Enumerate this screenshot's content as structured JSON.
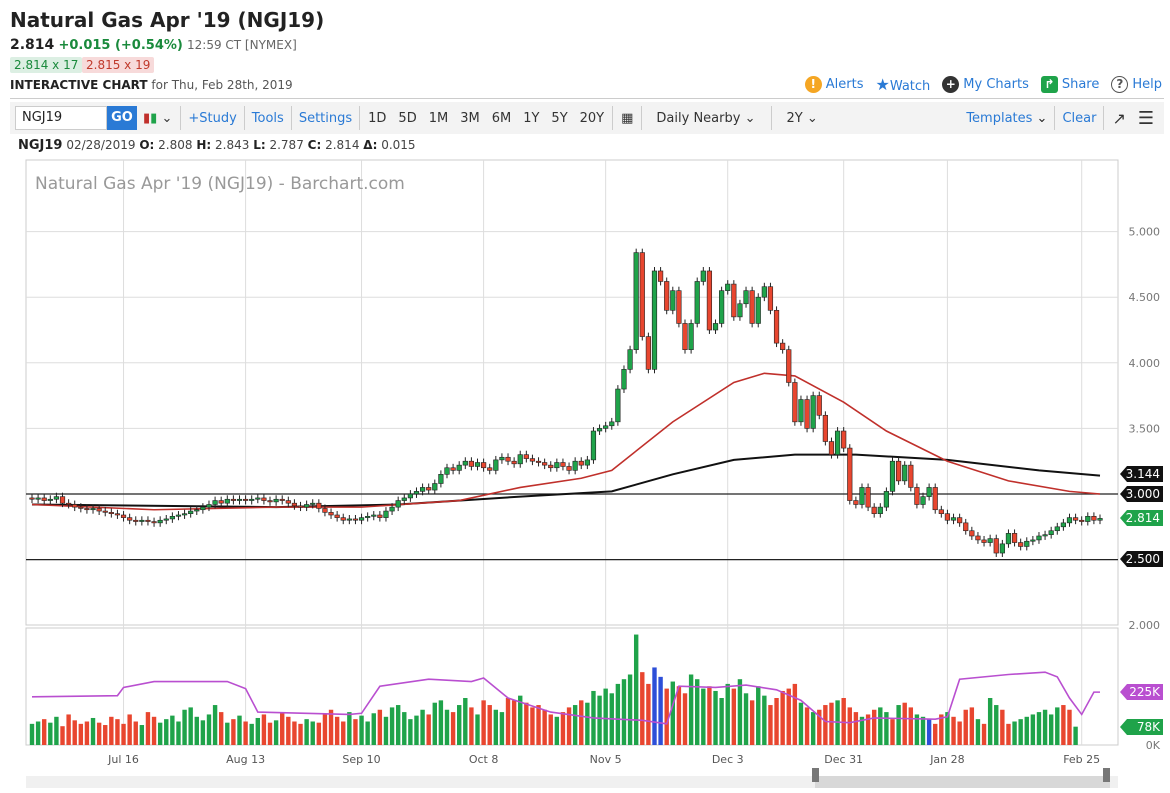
{
  "header": {
    "title": "Natural Gas Apr '19 (NGJ19)",
    "last": "2.814",
    "change": "+0.015 (+0.54%)",
    "time": "12:59 CT [NYMEX]",
    "bid": "2.814 x 17",
    "ask": "2.815 x 19",
    "ic_label": "INTERACTIVE CHART",
    "ic_date": "for Thu, Feb 28th, 2019"
  },
  "links": {
    "alerts": "Alerts",
    "watch": "Watch",
    "mycharts": "My Charts",
    "share": "Share",
    "help": "Help"
  },
  "toolbar": {
    "symbol": "NGJ19",
    "go": "GO",
    "study": "+Study",
    "tools": "Tools",
    "settings": "Settings",
    "periods": [
      "1D",
      "5D",
      "1M",
      "3M",
      "6M",
      "1Y",
      "5Y",
      "20Y"
    ],
    "interval": "Daily Nearby",
    "range": "2Y",
    "templates": "Templates",
    "clear": "Clear"
  },
  "ohlc": {
    "symbol": "NGJ19",
    "date": "02/28/2019",
    "o_label": "O:",
    "o": "2.808",
    "h_label": "H:",
    "h": "2.843",
    "l_label": "L:",
    "l": "2.787",
    "c_label": "C:",
    "c": "2.814",
    "d_label": "Δ:",
    "d": "0.015"
  },
  "colors": {
    "up": "#1fa34a",
    "down": "#e8462f",
    "ma_short": "#c0302b",
    "ma_long": "#111111",
    "oi": "#b94fd0",
    "vol_blue": "#2d4fd8"
  },
  "chart_data": {
    "type": "candlestick",
    "title": "Natural Gas Apr '19 (NGJ19) - Barchart.com",
    "ylim": [
      2.0,
      5.15
    ],
    "yticks": [
      "5.000",
      "4.500",
      "4.000",
      "3.500",
      "3.000",
      "2.500",
      "2.000"
    ],
    "xticks": [
      {
        "label": "Jul 16",
        "i": 15
      },
      {
        "label": "Aug 13",
        "i": 35
      },
      {
        "label": "Sep 10",
        "i": 54
      },
      {
        "label": "Oct 8",
        "i": 74
      },
      {
        "label": "Nov 5",
        "i": 94
      },
      {
        "label": "Dec 3",
        "i": 114
      },
      {
        "label": "Dec 31",
        "i": 133
      },
      {
        "label": "Jan 28",
        "i": 150
      },
      {
        "label": "Feb 25",
        "i": 172
      }
    ],
    "closes": [
      2.96,
      2.97,
      2.95,
      2.96,
      2.98,
      2.93,
      2.92,
      2.9,
      2.89,
      2.88,
      2.89,
      2.87,
      2.86,
      2.85,
      2.84,
      2.82,
      2.8,
      2.79,
      2.8,
      2.79,
      2.78,
      2.8,
      2.81,
      2.83,
      2.84,
      2.85,
      2.87,
      2.88,
      2.9,
      2.92,
      2.95,
      2.93,
      2.96,
      2.95,
      2.96,
      2.95,
      2.96,
      2.97,
      2.95,
      2.94,
      2.96,
      2.95,
      2.93,
      2.91,
      2.9,
      2.92,
      2.93,
      2.89,
      2.86,
      2.84,
      2.82,
      2.8,
      2.81,
      2.8,
      2.82,
      2.83,
      2.84,
      2.82,
      2.87,
      2.9,
      2.95,
      2.97,
      3.0,
      3.02,
      3.05,
      3.03,
      3.08,
      3.15,
      3.2,
      3.18,
      3.22,
      3.25,
      3.21,
      3.24,
      3.2,
      3.18,
      3.26,
      3.28,
      3.25,
      3.23,
      3.3,
      3.27,
      3.25,
      3.24,
      3.22,
      3.2,
      3.24,
      3.21,
      3.18,
      3.25,
      3.22,
      3.26,
      3.48,
      3.5,
      3.52,
      3.55,
      3.8,
      3.95,
      4.1,
      4.84,
      4.2,
      3.95,
      4.7,
      4.62,
      4.4,
      4.55,
      4.3,
      4.1,
      4.3,
      4.62,
      4.7,
      4.25,
      4.3,
      4.55,
      4.6,
      4.35,
      4.45,
      4.55,
      4.3,
      4.5,
      4.58,
      4.4,
      4.15,
      4.1,
      3.85,
      3.55,
      3.72,
      3.5,
      3.75,
      3.6,
      3.4,
      3.3,
      3.48,
      3.35,
      2.95,
      2.92,
      3.05,
      2.9,
      2.85,
      2.9,
      3.02,
      3.25,
      3.1,
      3.22,
      3.05,
      2.92,
      2.98,
      3.05,
      2.88,
      2.85,
      2.8,
      2.82,
      2.78,
      2.72,
      2.68,
      2.65,
      2.63,
      2.66,
      2.55,
      2.62,
      2.7,
      2.63,
      2.6,
      2.64,
      2.65,
      2.68,
      2.69,
      2.72,
      2.75,
      2.78,
      2.82,
      2.8,
      2.79,
      2.83,
      2.8,
      2.814
    ],
    "volume_k": [
      90,
      100,
      110,
      95,
      120,
      80,
      130,
      105,
      90,
      100,
      115,
      95,
      85,
      120,
      110,
      90,
      130,
      100,
      85,
      140,
      120,
      95,
      110,
      125,
      100,
      150,
      160,
      120,
      105,
      130,
      170,
      140,
      95,
      110,
      125,
      100,
      90,
      115,
      130,
      95,
      105,
      140,
      120,
      100,
      90,
      110,
      100,
      95,
      130,
      150,
      120,
      100,
      140,
      110,
      125,
      100,
      135,
      150,
      120,
      160,
      170,
      140,
      110,
      125,
      150,
      130,
      180,
      190,
      150,
      140,
      170,
      200,
      160,
      130,
      190,
      170,
      150,
      140,
      200,
      190,
      210,
      180,
      160,
      170,
      150,
      130,
      120,
      140,
      160,
      170,
      190,
      180,
      230,
      210,
      240,
      220,
      260,
      280,
      300,
      470,
      310,
      260,
      330,
      290,
      240,
      270,
      250,
      220,
      300,
      280,
      240,
      250,
      230,
      200,
      260,
      240,
      280,
      220,
      190,
      250,
      210,
      170,
      200,
      230,
      240,
      260,
      180,
      160,
      140,
      150,
      170,
      180,
      190,
      200,
      160,
      140,
      120,
      130,
      150,
      160,
      140,
      110,
      170,
      180,
      160,
      130,
      120,
      110,
      90,
      130,
      140,
      120,
      100,
      150,
      160,
      110,
      90,
      200,
      170,
      150,
      90,
      100,
      110,
      120,
      130,
      140,
      150,
      130,
      160,
      170,
      150,
      78
    ],
    "volume_up": [
      1,
      1,
      0,
      1,
      1,
      0,
      0,
      0,
      0,
      0,
      1,
      0,
      0,
      0,
      0,
      0,
      0,
      0,
      1,
      0,
      0,
      1,
      1,
      1,
      1,
      1,
      1,
      1,
      1,
      1,
      1,
      0,
      1,
      0,
      1,
      0,
      1,
      1,
      0,
      0,
      1,
      0,
      0,
      0,
      0,
      1,
      1,
      0,
      0,
      0,
      0,
      0,
      1,
      0,
      1,
      1,
      1,
      0,
      1,
      1,
      1,
      1,
      1,
      1,
      1,
      0,
      1,
      1,
      1,
      0,
      1,
      1,
      0,
      1,
      0,
      0,
      1,
      1,
      0,
      0,
      1,
      0,
      0,
      0,
      0,
      0,
      1,
      0,
      0,
      1,
      0,
      1,
      1,
      1,
      1,
      1,
      1,
      1,
      1,
      1,
      0,
      0,
      1,
      0,
      0,
      1,
      0,
      0,
      1,
      1,
      1,
      0,
      1,
      1,
      1,
      0,
      1,
      1,
      0,
      1,
      1,
      0,
      0,
      0,
      0,
      0,
      1,
      0,
      1,
      0,
      0,
      0,
      1,
      0,
      0,
      0,
      1,
      0,
      0,
      1,
      1,
      0,
      1,
      0,
      0,
      1,
      1,
      0,
      0,
      0,
      1,
      0,
      0,
      0,
      0,
      1,
      0,
      1,
      1,
      0,
      0,
      1,
      1,
      1,
      1,
      1,
      1,
      1,
      1,
      0,
      0,
      1,
      0,
      1
    ],
    "ma50": [
      [
        0,
        2.92
      ],
      [
        20,
        2.88
      ],
      [
        40,
        2.9
      ],
      [
        54,
        2.9
      ],
      [
        70,
        2.95
      ],
      [
        80,
        3.05
      ],
      [
        90,
        3.12
      ],
      [
        95,
        3.18
      ],
      [
        105,
        3.55
      ],
      [
        115,
        3.85
      ],
      [
        120,
        3.92
      ],
      [
        125,
        3.9
      ],
      [
        133,
        3.7
      ],
      [
        140,
        3.48
      ],
      [
        150,
        3.25
      ],
      [
        160,
        3.1
      ],
      [
        170,
        3.02
      ],
      [
        175,
        3.0
      ]
    ],
    "ma200": [
      [
        0,
        2.92
      ],
      [
        40,
        2.9
      ],
      [
        60,
        2.92
      ],
      [
        80,
        2.98
      ],
      [
        95,
        3.02
      ],
      [
        105,
        3.15
      ],
      [
        115,
        3.26
      ],
      [
        125,
        3.3
      ],
      [
        135,
        3.3
      ],
      [
        150,
        3.26
      ],
      [
        165,
        3.18
      ],
      [
        175,
        3.14
      ]
    ],
    "open_interest_k": [
      [
        0,
        205
      ],
      [
        14,
        210
      ],
      [
        15,
        245
      ],
      [
        20,
        270
      ],
      [
        32,
        270
      ],
      [
        35,
        240
      ],
      [
        37,
        140
      ],
      [
        52,
        130
      ],
      [
        54,
        135
      ],
      [
        57,
        250
      ],
      [
        65,
        280
      ],
      [
        72,
        270
      ],
      [
        74,
        285
      ],
      [
        78,
        200
      ],
      [
        85,
        140
      ],
      [
        92,
        115
      ],
      [
        100,
        105
      ],
      [
        104,
        90
      ],
      [
        106,
        250
      ],
      [
        112,
        245
      ],
      [
        117,
        255
      ],
      [
        122,
        235
      ],
      [
        126,
        190
      ],
      [
        130,
        100
      ],
      [
        134,
        95
      ],
      [
        138,
        115
      ],
      [
        148,
        110
      ],
      [
        150,
        120
      ],
      [
        152,
        280
      ],
      [
        160,
        300
      ],
      [
        166,
        310
      ],
      [
        168,
        290
      ],
      [
        170,
        200
      ],
      [
        172,
        130
      ],
      [
        174,
        225
      ],
      [
        175,
        225
      ]
    ],
    "hlines": [
      3.0,
      2.5
    ],
    "labels": {
      "ma200": "3.144",
      "hline_top": "3.000",
      "last": "2.814",
      "hline_bottom": "2.500",
      "vol_ticks": [
        "0K"
      ],
      "vol_top": "2.000",
      "oi_last": "225K",
      "vol_last": "78K"
    }
  }
}
